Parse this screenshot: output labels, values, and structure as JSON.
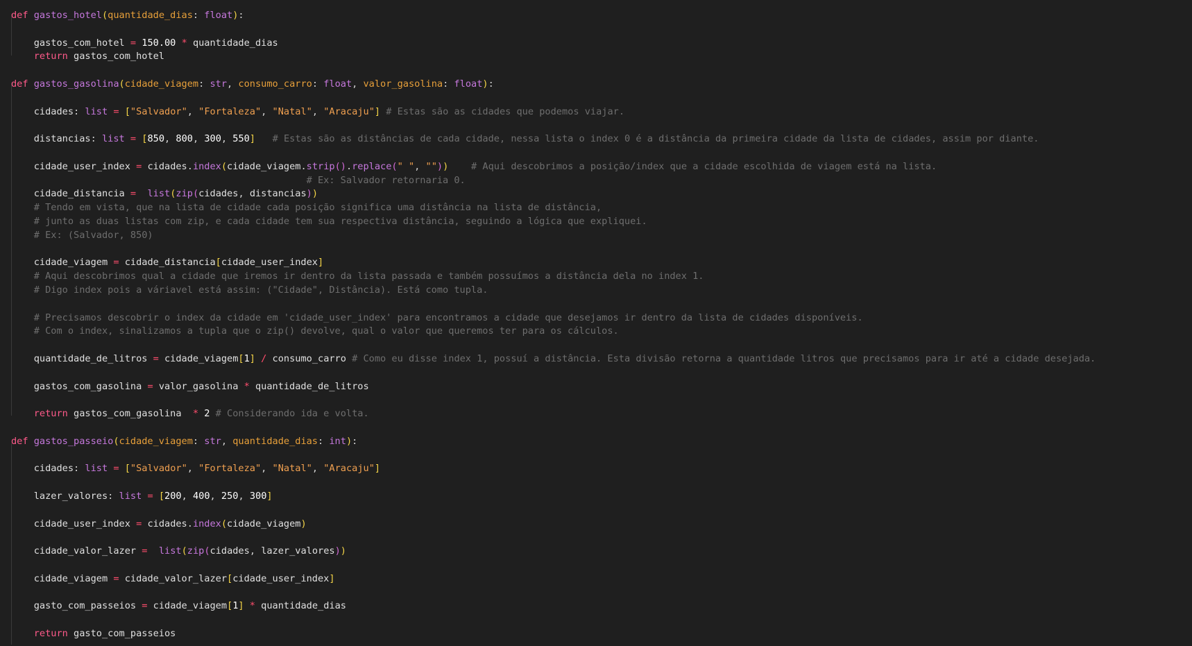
{
  "editor": {
    "colors": {
      "background": "#1f1f1f",
      "keyword": "#ff5a8a",
      "function": "#c678dd",
      "parameter": "#e8a03a",
      "string": "#f0a050",
      "comment": "#6e6e6e",
      "bracket_level_1": "#f5d547",
      "bracket_level_2": "#d16ad6"
    },
    "lines": [
      [
        [
          "kw",
          "def"
        ],
        [
          "pn",
          " "
        ],
        [
          "fn",
          "gastos_hotel"
        ],
        [
          "b1",
          "("
        ],
        [
          "prm",
          "quantidade_dias"
        ],
        [
          "pn",
          ": "
        ],
        [
          "ty",
          "float"
        ],
        [
          "b1",
          ")"
        ],
        [
          "pn",
          ":"
        ]
      ],
      [],
      [
        [
          "pn",
          "    "
        ],
        [
          "id",
          "gastos_com_hotel"
        ],
        [
          "pn",
          " "
        ],
        [
          "op",
          "="
        ],
        [
          "pn",
          " "
        ],
        [
          "num",
          "150.00"
        ],
        [
          "pn",
          " "
        ],
        [
          "op",
          "*"
        ],
        [
          "pn",
          " "
        ],
        [
          "id",
          "quantidade_dias"
        ]
      ],
      [
        [
          "pn",
          "    "
        ],
        [
          "kw",
          "return"
        ],
        [
          "pn",
          " "
        ],
        [
          "id",
          "gastos_com_hotel"
        ]
      ],
      [],
      [
        [
          "kw",
          "def"
        ],
        [
          "pn",
          " "
        ],
        [
          "fn",
          "gastos_gasolina"
        ],
        [
          "b1",
          "("
        ],
        [
          "prm",
          "cidade_viagem"
        ],
        [
          "pn",
          ": "
        ],
        [
          "ty",
          "str"
        ],
        [
          "pn",
          ", "
        ],
        [
          "prm",
          "consumo_carro"
        ],
        [
          "pn",
          ": "
        ],
        [
          "ty",
          "float"
        ],
        [
          "pn",
          ", "
        ],
        [
          "prm",
          "valor_gasolina"
        ],
        [
          "pn",
          ": "
        ],
        [
          "ty",
          "float"
        ],
        [
          "b1",
          ")"
        ],
        [
          "pn",
          ":"
        ]
      ],
      [],
      [
        [
          "pn",
          "    "
        ],
        [
          "id",
          "cidades"
        ],
        [
          "pn",
          ": "
        ],
        [
          "ty",
          "list"
        ],
        [
          "pn",
          " "
        ],
        [
          "op",
          "="
        ],
        [
          "pn",
          " "
        ],
        [
          "b1",
          "["
        ],
        [
          "str",
          "\"Salvador\""
        ],
        [
          "pn",
          ", "
        ],
        [
          "str",
          "\"Fortaleza\""
        ],
        [
          "pn",
          ", "
        ],
        [
          "str",
          "\"Natal\""
        ],
        [
          "pn",
          ", "
        ],
        [
          "str",
          "\"Aracaju\""
        ],
        [
          "b1",
          "]"
        ],
        [
          "pn",
          " "
        ],
        [
          "cm",
          "# Estas são as cidades que podemos viajar."
        ]
      ],
      [],
      [
        [
          "pn",
          "    "
        ],
        [
          "id",
          "distancias"
        ],
        [
          "pn",
          ": "
        ],
        [
          "ty",
          "list"
        ],
        [
          "pn",
          " "
        ],
        [
          "op",
          "="
        ],
        [
          "pn",
          " "
        ],
        [
          "b1",
          "["
        ],
        [
          "num",
          "850"
        ],
        [
          "pn",
          ", "
        ],
        [
          "num",
          "800"
        ],
        [
          "pn",
          ", "
        ],
        [
          "num",
          "300"
        ],
        [
          "pn",
          ", "
        ],
        [
          "num",
          "550"
        ],
        [
          "b1",
          "]"
        ],
        [
          "pn",
          "   "
        ],
        [
          "cm",
          "# Estas são as distâncias de cada cidade, nessa lista o index 0 é a distância da primeira cidade da lista de cidades, assim por diante."
        ]
      ],
      [],
      [
        [
          "pn",
          "    "
        ],
        [
          "id",
          "cidade_user_index"
        ],
        [
          "pn",
          " "
        ],
        [
          "op",
          "="
        ],
        [
          "pn",
          " "
        ],
        [
          "id",
          "cidades"
        ],
        [
          "pn",
          "."
        ],
        [
          "fn",
          "index"
        ],
        [
          "b1",
          "("
        ],
        [
          "id",
          "cidade_viagem"
        ],
        [
          "pn",
          "."
        ],
        [
          "fn",
          "strip"
        ],
        [
          "b2",
          "()"
        ],
        [
          "pn",
          "."
        ],
        [
          "fn",
          "replace"
        ],
        [
          "b2",
          "("
        ],
        [
          "str",
          "\" \""
        ],
        [
          "pn",
          ", "
        ],
        [
          "str",
          "\"\""
        ],
        [
          "b2",
          ")"
        ],
        [
          "b1",
          ")"
        ],
        [
          "pn",
          "    "
        ],
        [
          "cm",
          "# Aqui descobrimos a posição/index que a cidade escolhida de viagem está na lista."
        ]
      ],
      [
        [
          "pn",
          "                                                    "
        ],
        [
          "cm",
          "# Ex: Salvador retornaria 0."
        ]
      ],
      [
        [
          "pn",
          "    "
        ],
        [
          "id",
          "cidade_distancia"
        ],
        [
          "pn",
          " "
        ],
        [
          "op",
          "="
        ],
        [
          "pn",
          "  "
        ],
        [
          "ty",
          "list"
        ],
        [
          "b1",
          "("
        ],
        [
          "fn",
          "zip"
        ],
        [
          "b2",
          "("
        ],
        [
          "id",
          "cidades"
        ],
        [
          "pn",
          ", "
        ],
        [
          "id",
          "distancias"
        ],
        [
          "b2",
          ")"
        ],
        [
          "b1",
          ")"
        ]
      ],
      [
        [
          "pn",
          "    "
        ],
        [
          "cm",
          "# Tendo em vista, que na lista de cidade cada posição significa uma distância na lista de distância,"
        ]
      ],
      [
        [
          "pn",
          "    "
        ],
        [
          "cm",
          "# junto as duas listas com zip, e cada cidade tem sua respectiva distância, seguindo a lógica que expliquei."
        ]
      ],
      [
        [
          "pn",
          "    "
        ],
        [
          "cm",
          "# Ex: (Salvador, 850)"
        ]
      ],
      [],
      [
        [
          "pn",
          "    "
        ],
        [
          "id",
          "cidade_viagem"
        ],
        [
          "pn",
          " "
        ],
        [
          "op",
          "="
        ],
        [
          "pn",
          " "
        ],
        [
          "id",
          "cidade_distancia"
        ],
        [
          "b1",
          "["
        ],
        [
          "id",
          "cidade_user_index"
        ],
        [
          "b1",
          "]"
        ]
      ],
      [
        [
          "pn",
          "    "
        ],
        [
          "cm",
          "# Aqui descobrimos qual a cidade que iremos ir dentro da lista passada e também possuímos a distância dela no index 1."
        ]
      ],
      [
        [
          "pn",
          "    "
        ],
        [
          "cm",
          "# Digo index pois a váriavel está assim: (\"Cidade\", Distância). Está como tupla."
        ]
      ],
      [],
      [
        [
          "pn",
          "    "
        ],
        [
          "cm",
          "# Precisamos descobrir o index da cidade em 'cidade_user_index' para encontramos a cidade que desejamos ir dentro da lista de cidades disponíveis."
        ]
      ],
      [
        [
          "pn",
          "    "
        ],
        [
          "cm",
          "# Com o index, sinalizamos a tupla que o zip() devolve, qual o valor que queremos ter para os cálculos."
        ]
      ],
      [],
      [
        [
          "pn",
          "    "
        ],
        [
          "id",
          "quantidade_de_litros"
        ],
        [
          "pn",
          " "
        ],
        [
          "op",
          "="
        ],
        [
          "pn",
          " "
        ],
        [
          "id",
          "cidade_viagem"
        ],
        [
          "b1",
          "["
        ],
        [
          "num",
          "1"
        ],
        [
          "b1",
          "]"
        ],
        [
          "pn",
          " "
        ],
        [
          "op",
          "/"
        ],
        [
          "pn",
          " "
        ],
        [
          "id",
          "consumo_carro"
        ],
        [
          "pn",
          " "
        ],
        [
          "cm",
          "# Como eu disse index 1, possuí a distância. Esta divisão retorna a quantidade litros que precisamos para ir até a cidade desejada."
        ]
      ],
      [],
      [
        [
          "pn",
          "    "
        ],
        [
          "id",
          "gastos_com_gasolina"
        ],
        [
          "pn",
          " "
        ],
        [
          "op",
          "="
        ],
        [
          "pn",
          " "
        ],
        [
          "id",
          "valor_gasolina"
        ],
        [
          "pn",
          " "
        ],
        [
          "op",
          "*"
        ],
        [
          "pn",
          " "
        ],
        [
          "id",
          "quantidade_de_litros"
        ]
      ],
      [],
      [
        [
          "pn",
          "    "
        ],
        [
          "kw",
          "return"
        ],
        [
          "pn",
          " "
        ],
        [
          "id",
          "gastos_com_gasolina"
        ],
        [
          "pn",
          "  "
        ],
        [
          "op",
          "*"
        ],
        [
          "pn",
          " "
        ],
        [
          "num",
          "2"
        ],
        [
          "pn",
          " "
        ],
        [
          "cm",
          "# Considerando ida e volta."
        ]
      ],
      [],
      [
        [
          "kw",
          "def"
        ],
        [
          "pn",
          " "
        ],
        [
          "fn",
          "gastos_passeio"
        ],
        [
          "b1",
          "("
        ],
        [
          "prm",
          "cidade_viagem"
        ],
        [
          "pn",
          ": "
        ],
        [
          "ty",
          "str"
        ],
        [
          "pn",
          ", "
        ],
        [
          "prm",
          "quantidade_dias"
        ],
        [
          "pn",
          ": "
        ],
        [
          "ty",
          "int"
        ],
        [
          "b1",
          ")"
        ],
        [
          "pn",
          ":"
        ]
      ],
      [],
      [
        [
          "pn",
          "    "
        ],
        [
          "id",
          "cidades"
        ],
        [
          "pn",
          ": "
        ],
        [
          "ty",
          "list"
        ],
        [
          "pn",
          " "
        ],
        [
          "op",
          "="
        ],
        [
          "pn",
          " "
        ],
        [
          "b1",
          "["
        ],
        [
          "str",
          "\"Salvador\""
        ],
        [
          "pn",
          ", "
        ],
        [
          "str",
          "\"Fortaleza\""
        ],
        [
          "pn",
          ", "
        ],
        [
          "str",
          "\"Natal\""
        ],
        [
          "pn",
          ", "
        ],
        [
          "str",
          "\"Aracaju\""
        ],
        [
          "b1",
          "]"
        ]
      ],
      [],
      [
        [
          "pn",
          "    "
        ],
        [
          "id",
          "lazer_valores"
        ],
        [
          "pn",
          ": "
        ],
        [
          "ty",
          "list"
        ],
        [
          "pn",
          " "
        ],
        [
          "op",
          "="
        ],
        [
          "pn",
          " "
        ],
        [
          "b1",
          "["
        ],
        [
          "num",
          "200"
        ],
        [
          "pn",
          ", "
        ],
        [
          "num",
          "400"
        ],
        [
          "pn",
          ", "
        ],
        [
          "num",
          "250"
        ],
        [
          "pn",
          ", "
        ],
        [
          "num",
          "300"
        ],
        [
          "b1",
          "]"
        ]
      ],
      [],
      [
        [
          "pn",
          "    "
        ],
        [
          "id",
          "cidade_user_index"
        ],
        [
          "pn",
          " "
        ],
        [
          "op",
          "="
        ],
        [
          "pn",
          " "
        ],
        [
          "id",
          "cidades"
        ],
        [
          "pn",
          "."
        ],
        [
          "fn",
          "index"
        ],
        [
          "b1",
          "("
        ],
        [
          "id",
          "cidade_viagem"
        ],
        [
          "b1",
          ")"
        ]
      ],
      [],
      [
        [
          "pn",
          "    "
        ],
        [
          "id",
          "cidade_valor_lazer"
        ],
        [
          "pn",
          " "
        ],
        [
          "op",
          "="
        ],
        [
          "pn",
          "  "
        ],
        [
          "ty",
          "list"
        ],
        [
          "b1",
          "("
        ],
        [
          "fn",
          "zip"
        ],
        [
          "b2",
          "("
        ],
        [
          "id",
          "cidades"
        ],
        [
          "pn",
          ", "
        ],
        [
          "id",
          "lazer_valores"
        ],
        [
          "b2",
          ")"
        ],
        [
          "b1",
          ")"
        ]
      ],
      [],
      [
        [
          "pn",
          "    "
        ],
        [
          "id",
          "cidade_viagem"
        ],
        [
          "pn",
          " "
        ],
        [
          "op",
          "="
        ],
        [
          "pn",
          " "
        ],
        [
          "id",
          "cidade_valor_lazer"
        ],
        [
          "b1",
          "["
        ],
        [
          "id",
          "cidade_user_index"
        ],
        [
          "b1",
          "]"
        ]
      ],
      [],
      [
        [
          "pn",
          "    "
        ],
        [
          "id",
          "gasto_com_passeios"
        ],
        [
          "pn",
          " "
        ],
        [
          "op",
          "="
        ],
        [
          "pn",
          " "
        ],
        [
          "id",
          "cidade_viagem"
        ],
        [
          "b1",
          "["
        ],
        [
          "num",
          "1"
        ],
        [
          "b1",
          "]"
        ],
        [
          "pn",
          " "
        ],
        [
          "op",
          "*"
        ],
        [
          "pn",
          " "
        ],
        [
          "id",
          "quantidade_dias"
        ]
      ],
      [],
      [
        [
          "pn",
          "    "
        ],
        [
          "kw",
          "return"
        ],
        [
          "pn",
          " "
        ],
        [
          "id",
          "gasto_com_passeios"
        ]
      ]
    ]
  }
}
